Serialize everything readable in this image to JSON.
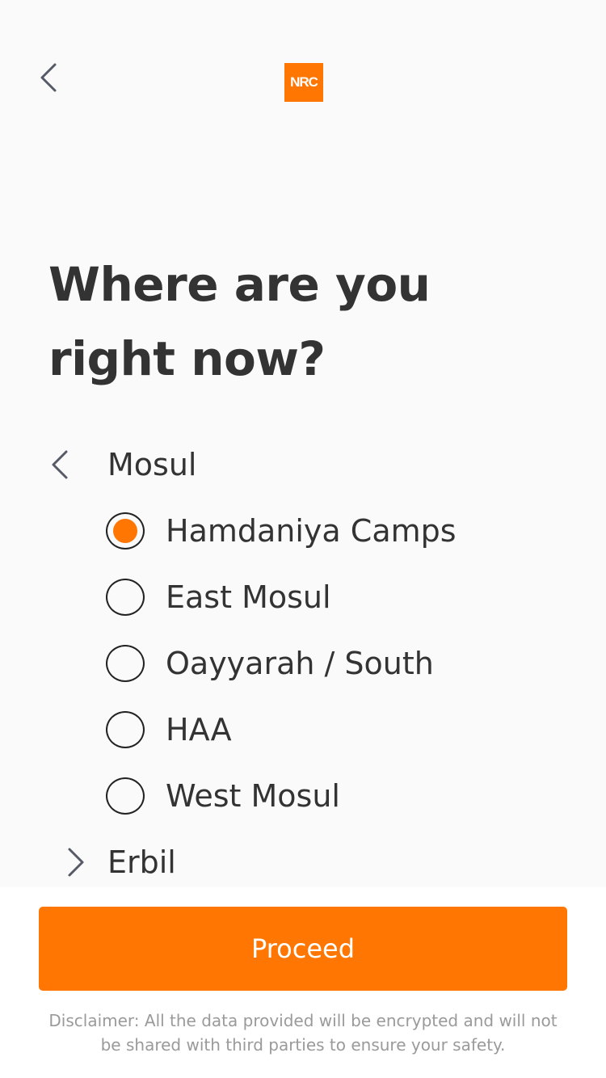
{
  "header": {
    "back_icon": "chevron-left-icon",
    "logo_text": "NRC",
    "logo_color": "#ff7602"
  },
  "question": {
    "line1": "Where are you",
    "line2": "right now?"
  },
  "groups": [
    {
      "label": "Mosul",
      "expanded": true,
      "icon": "chevron-left-icon",
      "options": [
        {
          "label": "Hamdaniya Camps",
          "selected": true
        },
        {
          "label": "East Mosul",
          "selected": false
        },
        {
          "label": "Oayyarah / South",
          "selected": false
        },
        {
          "label": "HAA",
          "selected": false
        },
        {
          "label": "West Mosul",
          "selected": false
        }
      ]
    },
    {
      "label": "Erbil",
      "expanded": false,
      "icon": "chevron-right-icon"
    }
  ],
  "footer": {
    "proceed_label": "Proceed",
    "disclaimer": "Disclaimer: All the data provided will be encrypted and will not be shared with third parties to ensure your safety."
  },
  "colors": {
    "accent": "#ff7602",
    "text": "#333333",
    "background": "#fafafa"
  }
}
